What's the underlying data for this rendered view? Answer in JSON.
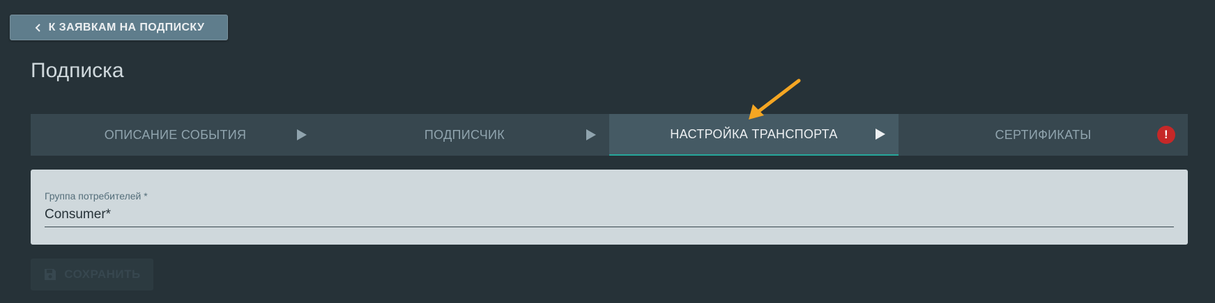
{
  "nav": {
    "back_label": "К ЗАЯВКАМ НА ПОДПИСКУ"
  },
  "page": {
    "title": "Подписка"
  },
  "stepper": {
    "steps": [
      {
        "label": "ОПИСАНИЕ СОБЫТИЯ",
        "state": "default"
      },
      {
        "label": "ПОДПИСЧИК",
        "state": "default"
      },
      {
        "label": "НАСТРОЙКА ТРАНСПОРТА",
        "state": "active"
      },
      {
        "label": "СЕРТИФИКАТЫ",
        "state": "error"
      }
    ],
    "error_glyph": "!"
  },
  "form": {
    "consumer_group": {
      "label": "Группа потребителей *",
      "value": "Consumer*"
    }
  },
  "actions": {
    "save_label": "СОХРАНИТЬ"
  },
  "colors": {
    "background": "#263238",
    "stepper_bg": "#37474f",
    "active_step_bg": "#455a64",
    "active_underline": "#26a69a",
    "error": "#c62828",
    "annotation_arrow": "#f5a623"
  },
  "icons": {
    "back": "chevron-left-icon",
    "step_separator": "play-arrow-icon",
    "step_error": "error-icon",
    "save": "floppy-disk-icon"
  }
}
